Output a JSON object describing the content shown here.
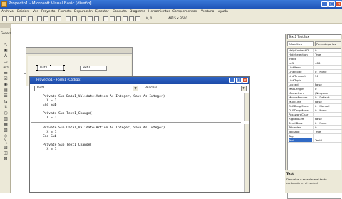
{
  "app": {
    "title": "Proyecto1 - Microsoft Visual Basic [diseño]"
  },
  "menu": [
    "Archivo",
    "Edición",
    "Ver",
    "Proyecto",
    "Formato",
    "Depuración",
    "Ejecutar",
    "Consulta",
    "Diagrama",
    "Herramientas",
    "Complementos",
    "Ventana",
    "Ayuda"
  ],
  "toolbar": {
    "coords1": "0, 0",
    "coords2": "4815 x 3600"
  },
  "toolbox": {
    "title": "General"
  },
  "form": {
    "textbox1": "Text1",
    "textbox2": "Text2"
  },
  "code_window": {
    "title": "Proyecto1 - Form1 (Código)",
    "object_combo": "Text1",
    "event_combo": "Validate",
    "pane1_lines": [
      "Private Sub Data1_Validate(Action As Integer, Save As Integer)",
      "  X = 1",
      "End Sub",
      "",
      "Private Sub Text1_Change()",
      "  X = 1",
      "End Sub"
    ],
    "pane2_lines": [
      "Private Sub Data1_Validate(Action As Integer, Save As Integer)",
      "  X = 1",
      "End Sub",
      "",
      "Private Sub Text1_Change()",
      "  X = 1"
    ]
  },
  "properties": {
    "object": "Text1 TextBox",
    "tabs": [
      "Alfabética",
      "Por categorías"
    ],
    "rows": [
      [
        "HelpContextID",
        "0"
      ],
      [
        "HideSelection",
        "True"
      ],
      [
        "Index",
        ""
      ],
      [
        "Left",
        "480"
      ],
      [
        "LinkItem",
        ""
      ],
      [
        "LinkMode",
        "0 - None"
      ],
      [
        "LinkTimeout",
        "50"
      ],
      [
        "LinkTopic",
        ""
      ],
      [
        "Locked",
        "False"
      ],
      [
        "MaxLength",
        "0"
      ],
      [
        "MouseIcon",
        "(Ninguno)"
      ],
      [
        "MousePointer",
        "0 - Default"
      ],
      [
        "MultiLine",
        "False"
      ],
      [
        "OLEDragMode",
        "0 - Manual"
      ],
      [
        "OLEDropMode",
        "0 - None"
      ],
      [
        "PasswordChar",
        ""
      ],
      [
        "RightToLeft",
        "False"
      ],
      [
        "ScrollBars",
        "0 - None"
      ],
      [
        "TabIndex",
        "0"
      ],
      [
        "TabStop",
        "True"
      ],
      [
        "Tag",
        ""
      ],
      [
        "Text",
        "Text1"
      ]
    ],
    "selected_index": 21,
    "desc_title": "Text",
    "desc_text": "Devuelve o establece el texto contenido en el control."
  }
}
